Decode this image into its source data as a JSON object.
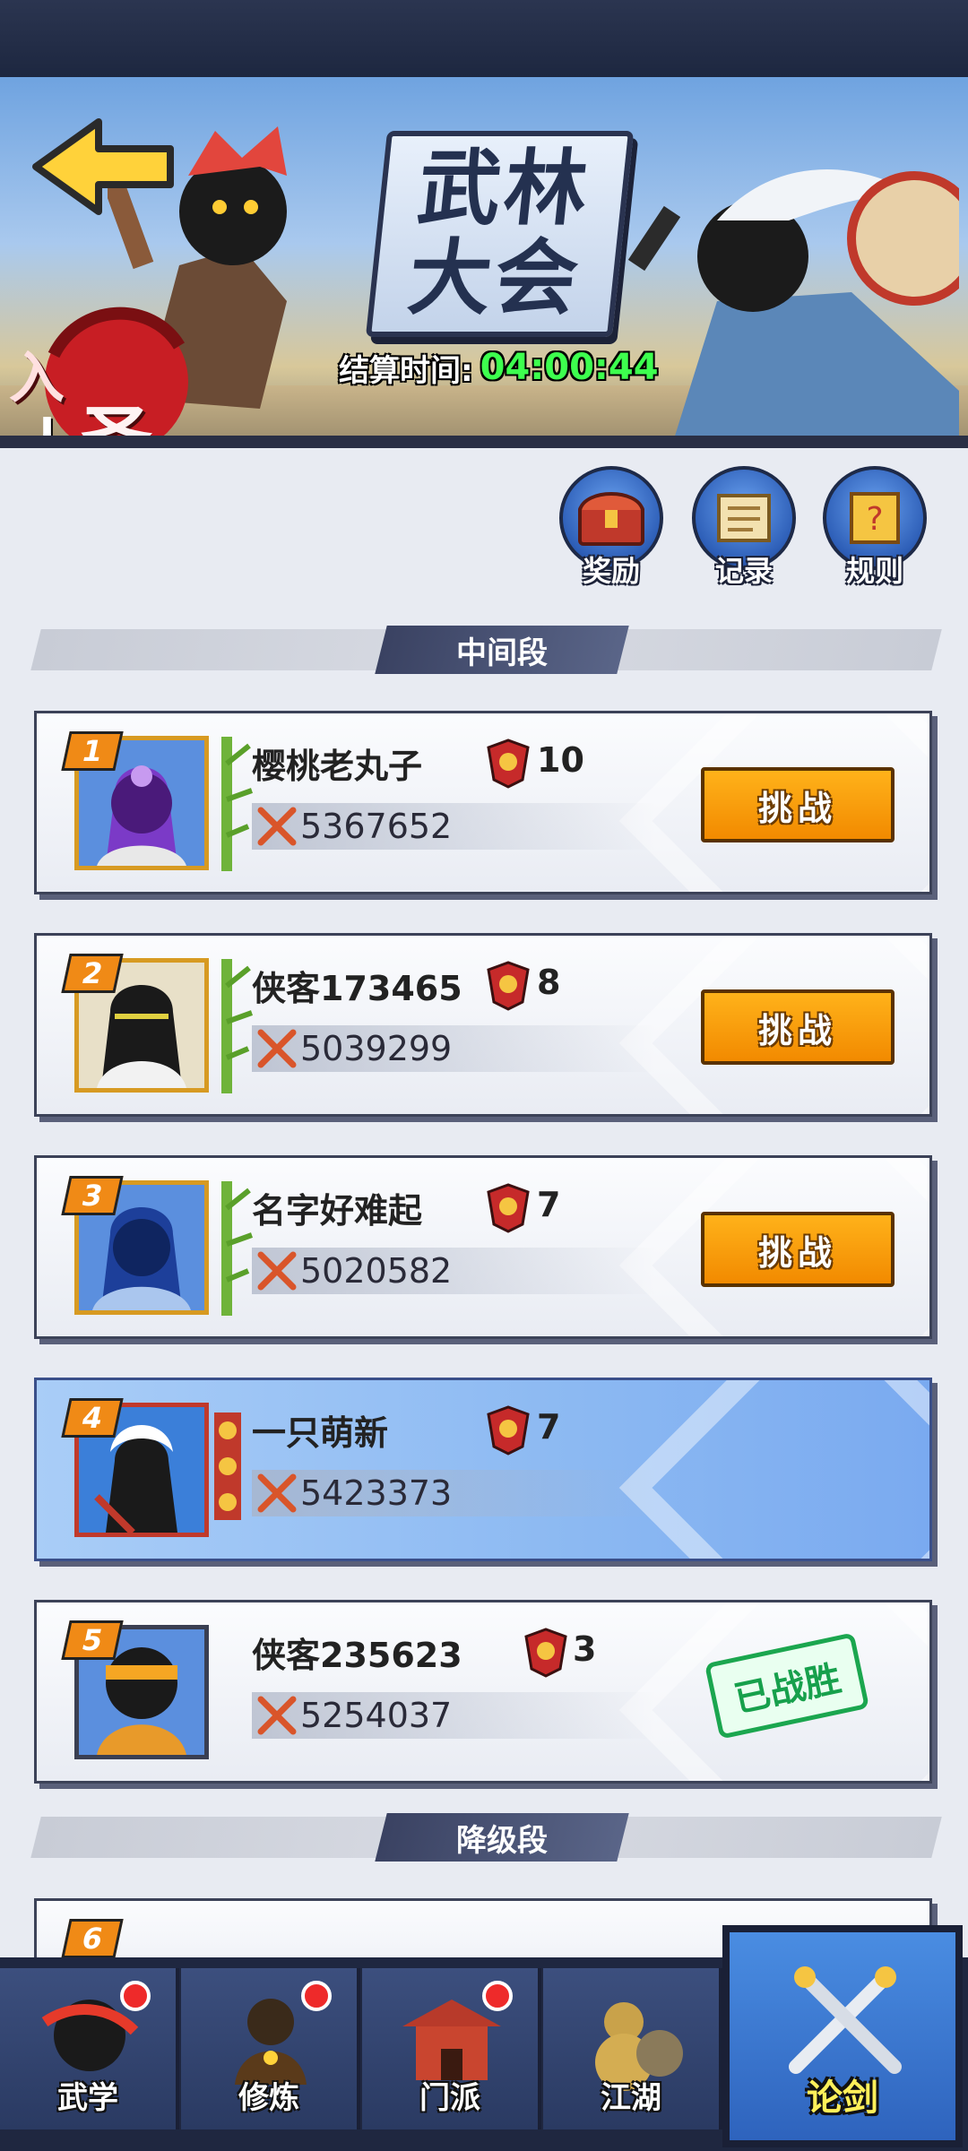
{
  "banner": {
    "title_line1": "武林",
    "title_line2": "大会",
    "timer_label": "结算时间:",
    "timer_value": "04:00:44",
    "rank_badge_top": "入",
    "rank_badge_main": "圣",
    "rank_badge_level": "I"
  },
  "actions": [
    {
      "label": "奖励",
      "icon": "treasure-chest-icon"
    },
    {
      "label": "记录",
      "icon": "scroll-icon"
    },
    {
      "label": "规则",
      "icon": "rules-scroll-icon"
    }
  ],
  "sections": {
    "middle": "中间段",
    "demotion": "降级段"
  },
  "players": [
    {
      "rank": "1",
      "name": "樱桃老丸子",
      "score": "10",
      "power": "5367652",
      "action": "挑战"
    },
    {
      "rank": "2",
      "name": "侠客173465",
      "score": "8",
      "power": "5039299",
      "action": "挑战"
    },
    {
      "rank": "3",
      "name": "名字好难起",
      "score": "7",
      "power": "5020582",
      "action": "挑战"
    },
    {
      "rank": "4",
      "name": "一只萌新",
      "score": "7",
      "power": "5423373",
      "action": ""
    },
    {
      "rank": "5",
      "name": "侠客235623",
      "score": "3",
      "power": "5254037",
      "status": "已战胜"
    }
  ],
  "partial_rank": "6",
  "nav": [
    {
      "label": "武学",
      "badge": true
    },
    {
      "label": "修炼",
      "badge": true
    },
    {
      "label": "门派",
      "badge": true
    },
    {
      "label": "江湖",
      "badge": false
    },
    {
      "label": "论剑",
      "active": true
    }
  ],
  "colors": {
    "timer_green": "#3dff4e",
    "challenge_orange": "#f28a00",
    "won_green": "#17a04c",
    "self_card_blue": "#8cb9f2"
  }
}
